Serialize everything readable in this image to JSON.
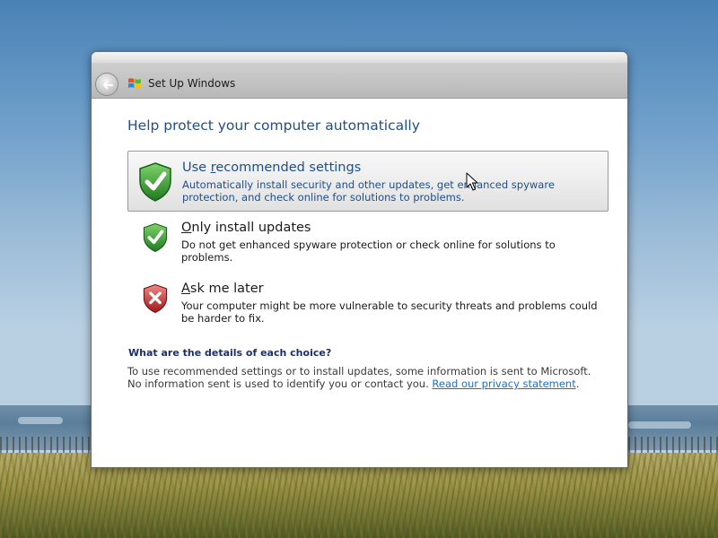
{
  "window": {
    "title": "Set Up Windows"
  },
  "page": {
    "heading": "Help protect your computer automatically"
  },
  "options": [
    {
      "title_prefix": "Use ",
      "title_mnemonic": "r",
      "title_suffix": "ecommended settings",
      "description": "Automatically install security and other updates, get enhanced spyware protection, and check online for solutions to problems.",
      "icon": "green-check-shield-icon",
      "selected": true
    },
    {
      "title_prefix": "",
      "title_mnemonic": "O",
      "title_suffix": "nly install updates",
      "description": "Do not get enhanced spyware protection or check online for solutions to problems.",
      "icon": "green-check-shield-icon",
      "selected": false
    },
    {
      "title_prefix": "",
      "title_mnemonic": "A",
      "title_suffix": "sk me later",
      "description": "Your computer might be more vulnerable to security threats and problems could be harder to fix.",
      "icon": "red-x-shield-icon",
      "selected": false
    }
  ],
  "details": {
    "heading": "What are the details of each choice?",
    "text": "To use recommended settings or to install updates, some information is sent to Microsoft. No information sent is used to identify you or contact you. ",
    "link": "Read our privacy statement",
    "trailing": "."
  },
  "colors": {
    "heading_blue": "#1f4f8b",
    "link_blue": "#1f6fbf",
    "shield_green": "#2e9a2e",
    "shield_red": "#c62828"
  }
}
